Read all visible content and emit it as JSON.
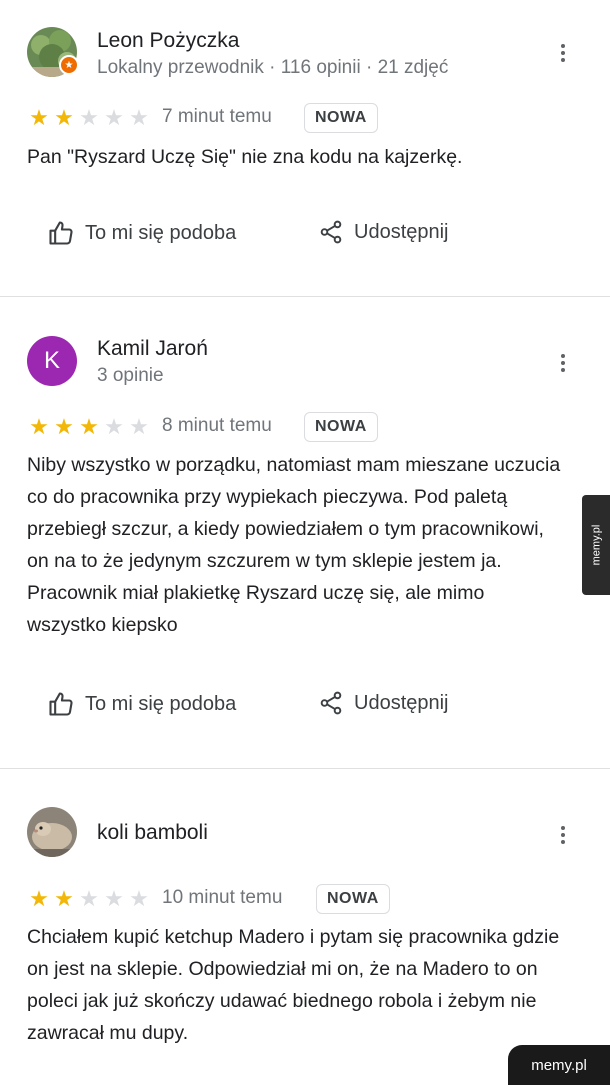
{
  "reviews": [
    {
      "name": "Leon Pożyczka",
      "meta": "Lokalny przewodnik · 116 opinii · 21 zdjęć",
      "rating": 2,
      "max_rating": 5,
      "time": "7 minut temu",
      "badge": "NOWA",
      "text": "Pan \"Ryszard Uczę Się\" nie zna kodu na kajzerkę.",
      "like_label": "To mi się podoba",
      "share_label": "Udostępnij",
      "avatar_icon": "bush-photo-avatar",
      "guide_icon": "local-guide-star-icon"
    },
    {
      "name": "Kamil Jaroń",
      "meta": "3 opinie",
      "avatar_letter": "K",
      "avatar_color": "#9c27b0",
      "rating": 3,
      "max_rating": 5,
      "time": "8 minut temu",
      "badge": "NOWA",
      "text": "Niby wszystko w porządku, natomiast mam mieszane uczucia co do pracownika przy wypiekach pieczywa. Pod paletą przebiegł szczur, a kiedy powiedziałem o tym pracownikowi, on na to że jedynym szczurem w tym sklepie jestem ja. Pracownik miał plakietkę Ryszard uczę się, ale mimo wszystko kiepsko",
      "like_label": "To mi się podoba",
      "share_label": "Udostępnij"
    },
    {
      "name": "koli bamboli",
      "meta": "",
      "rating": 2,
      "max_rating": 5,
      "time": "10 minut temu",
      "badge": "NOWA",
      "text": "Chciałem kupić ketchup Madero i pytam się pracownika gdzie on jest na sklepie. Odpowiedział mi on, że na Madero to on poleci jak już skończy udawać biednego robola i żebym nie zawracał mu dupy.",
      "avatar_icon": "rodent-photo-avatar"
    }
  ],
  "watermark_side": "memy.pl",
  "watermark_corner": "memy.pl",
  "colors": {
    "star_on": "#f2b707",
    "star_off": "#dadce0",
    "avatar_k": "#9c27b0",
    "guide_badge": "#ef6c00"
  }
}
